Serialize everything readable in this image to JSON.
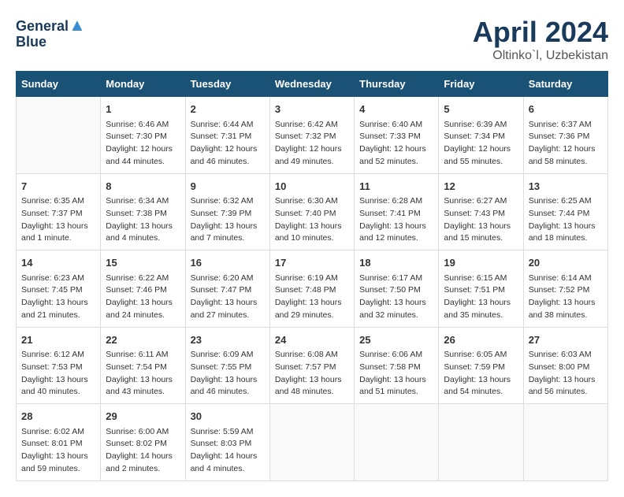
{
  "header": {
    "logo_line1": "General",
    "logo_line2": "Blue",
    "month": "April 2024",
    "location": "Oltinko`l, Uzbekistan"
  },
  "weekdays": [
    "Sunday",
    "Monday",
    "Tuesday",
    "Wednesday",
    "Thursday",
    "Friday",
    "Saturday"
  ],
  "weeks": [
    [
      null,
      {
        "day": 1,
        "sunrise": "6:46 AM",
        "sunset": "7:30 PM",
        "daylight": "12 hours and 44 minutes."
      },
      {
        "day": 2,
        "sunrise": "6:44 AM",
        "sunset": "7:31 PM",
        "daylight": "12 hours and 46 minutes."
      },
      {
        "day": 3,
        "sunrise": "6:42 AM",
        "sunset": "7:32 PM",
        "daylight": "12 hours and 49 minutes."
      },
      {
        "day": 4,
        "sunrise": "6:40 AM",
        "sunset": "7:33 PM",
        "daylight": "12 hours and 52 minutes."
      },
      {
        "day": 5,
        "sunrise": "6:39 AM",
        "sunset": "7:34 PM",
        "daylight": "12 hours and 55 minutes."
      },
      {
        "day": 6,
        "sunrise": "6:37 AM",
        "sunset": "7:36 PM",
        "daylight": "12 hours and 58 minutes."
      }
    ],
    [
      {
        "day": 7,
        "sunrise": "6:35 AM",
        "sunset": "7:37 PM",
        "daylight": "13 hours and 1 minute."
      },
      {
        "day": 8,
        "sunrise": "6:34 AM",
        "sunset": "7:38 PM",
        "daylight": "13 hours and 4 minutes."
      },
      {
        "day": 9,
        "sunrise": "6:32 AM",
        "sunset": "7:39 PM",
        "daylight": "13 hours and 7 minutes."
      },
      {
        "day": 10,
        "sunrise": "6:30 AM",
        "sunset": "7:40 PM",
        "daylight": "13 hours and 10 minutes."
      },
      {
        "day": 11,
        "sunrise": "6:28 AM",
        "sunset": "7:41 PM",
        "daylight": "13 hours and 12 minutes."
      },
      {
        "day": 12,
        "sunrise": "6:27 AM",
        "sunset": "7:43 PM",
        "daylight": "13 hours and 15 minutes."
      },
      {
        "day": 13,
        "sunrise": "6:25 AM",
        "sunset": "7:44 PM",
        "daylight": "13 hours and 18 minutes."
      }
    ],
    [
      {
        "day": 14,
        "sunrise": "6:23 AM",
        "sunset": "7:45 PM",
        "daylight": "13 hours and 21 minutes."
      },
      {
        "day": 15,
        "sunrise": "6:22 AM",
        "sunset": "7:46 PM",
        "daylight": "13 hours and 24 minutes."
      },
      {
        "day": 16,
        "sunrise": "6:20 AM",
        "sunset": "7:47 PM",
        "daylight": "13 hours and 27 minutes."
      },
      {
        "day": 17,
        "sunrise": "6:19 AM",
        "sunset": "7:48 PM",
        "daylight": "13 hours and 29 minutes."
      },
      {
        "day": 18,
        "sunrise": "6:17 AM",
        "sunset": "7:50 PM",
        "daylight": "13 hours and 32 minutes."
      },
      {
        "day": 19,
        "sunrise": "6:15 AM",
        "sunset": "7:51 PM",
        "daylight": "13 hours and 35 minutes."
      },
      {
        "day": 20,
        "sunrise": "6:14 AM",
        "sunset": "7:52 PM",
        "daylight": "13 hours and 38 minutes."
      }
    ],
    [
      {
        "day": 21,
        "sunrise": "6:12 AM",
        "sunset": "7:53 PM",
        "daylight": "13 hours and 40 minutes."
      },
      {
        "day": 22,
        "sunrise": "6:11 AM",
        "sunset": "7:54 PM",
        "daylight": "13 hours and 43 minutes."
      },
      {
        "day": 23,
        "sunrise": "6:09 AM",
        "sunset": "7:55 PM",
        "daylight": "13 hours and 46 minutes."
      },
      {
        "day": 24,
        "sunrise": "6:08 AM",
        "sunset": "7:57 PM",
        "daylight": "13 hours and 48 minutes."
      },
      {
        "day": 25,
        "sunrise": "6:06 AM",
        "sunset": "7:58 PM",
        "daylight": "13 hours and 51 minutes."
      },
      {
        "day": 26,
        "sunrise": "6:05 AM",
        "sunset": "7:59 PM",
        "daylight": "13 hours and 54 minutes."
      },
      {
        "day": 27,
        "sunrise": "6:03 AM",
        "sunset": "8:00 PM",
        "daylight": "13 hours and 56 minutes."
      }
    ],
    [
      {
        "day": 28,
        "sunrise": "6:02 AM",
        "sunset": "8:01 PM",
        "daylight": "13 hours and 59 minutes."
      },
      {
        "day": 29,
        "sunrise": "6:00 AM",
        "sunset": "8:02 PM",
        "daylight": "14 hours and 2 minutes."
      },
      {
        "day": 30,
        "sunrise": "5:59 AM",
        "sunset": "8:03 PM",
        "daylight": "14 hours and 4 minutes."
      },
      null,
      null,
      null,
      null
    ]
  ]
}
